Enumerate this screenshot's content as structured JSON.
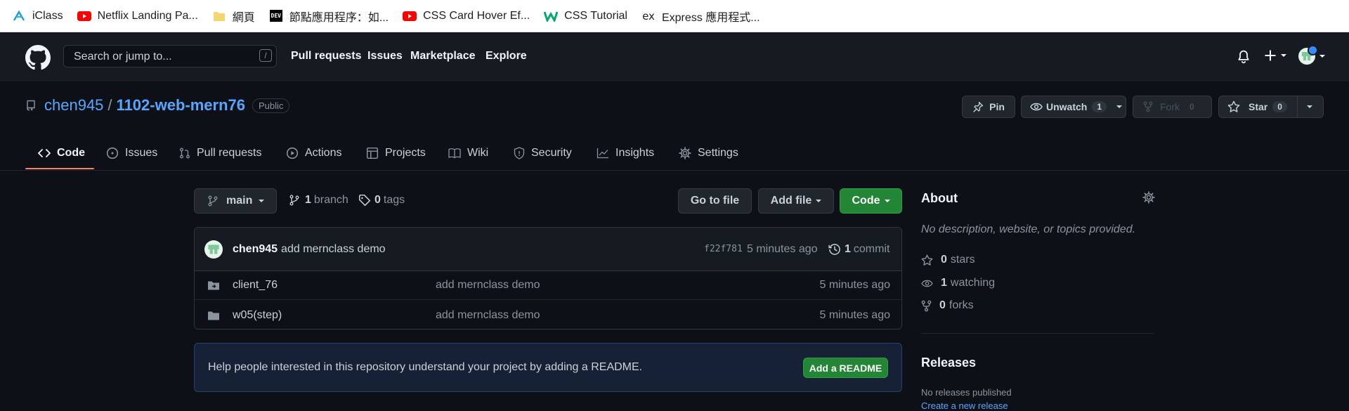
{
  "bookmarks": [
    {
      "label": "iClass",
      "icon": "iclass-icon"
    },
    {
      "label": "Netflix Landing Pa...",
      "icon": "youtube-icon"
    },
    {
      "label": "網頁",
      "icon": "folder-icon"
    },
    {
      "label": "節點應用程序：如...",
      "icon": "dev-icon"
    },
    {
      "label": "CSS Card Hover Ef...",
      "icon": "youtube-icon"
    },
    {
      "label": "CSS Tutorial",
      "icon": "w3schools-icon"
    },
    {
      "label": "Express 應用程式...",
      "icon": "express-icon"
    }
  ],
  "bookmark_dev_text": "DEV",
  "bookmark_express_text": "ex",
  "header": {
    "search_placeholder": "Search or jump to...",
    "search_shortcut": "/",
    "nav": [
      "Pull requests",
      "Issues",
      "Marketplace",
      "Explore"
    ]
  },
  "repo": {
    "owner": "chen945",
    "separator": "/",
    "name": "1102-web-mern76",
    "visibility": "Public",
    "pin_label": "Pin",
    "unwatch_label": "Unwatch",
    "unwatch_count": "1",
    "fork_label": "Fork",
    "fork_count": "0",
    "star_label": "Star",
    "star_count": "0"
  },
  "tabs": [
    "Code",
    "Issues",
    "Pull requests",
    "Actions",
    "Projects",
    "Wiki",
    "Security",
    "Insights",
    "Settings"
  ],
  "active_tab": "Code",
  "filenav": {
    "branch": "main",
    "branch_count": "1",
    "branch_label": "branch",
    "tag_count": "0",
    "tag_label": "tags",
    "goto_file": "Go to file",
    "add_file": "Add file",
    "code": "Code"
  },
  "latest_commit": {
    "author": "chen945",
    "message": "add mernclass demo",
    "sha": "f22f781",
    "time": "5 minutes ago",
    "commit_count": "1",
    "commit_label": "commit"
  },
  "files": [
    {
      "name": "client_76",
      "type": "submodule-folder",
      "message": "add mernclass demo",
      "time": "5 minutes ago"
    },
    {
      "name": "w05(step)",
      "type": "folder",
      "message": "add mernclass demo",
      "time": "5 minutes ago"
    }
  ],
  "readme_banner": {
    "text": "Help people interested in this repository understand your project by adding a README.",
    "button": "Add a README"
  },
  "about": {
    "title": "About",
    "description": "No description, website, or topics provided.",
    "stars": "0",
    "stars_label": "stars",
    "watching": "1",
    "watching_label": "watching",
    "forks": "0",
    "forks_label": "forks"
  },
  "releases": {
    "title": "Releases",
    "none_text": "No releases published",
    "create_link": "Create a new release"
  },
  "colors": {
    "background": "#0d1117",
    "header": "#161b22",
    "link": "#58a6ff",
    "green_button": "#238636",
    "tab_underline": "#f78166"
  }
}
